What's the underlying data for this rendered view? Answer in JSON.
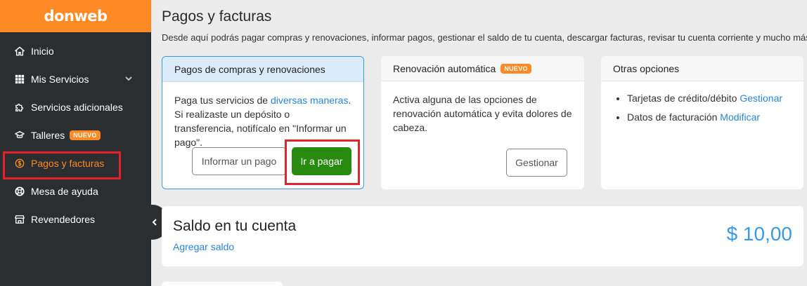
{
  "brand": {
    "name": "donweb"
  },
  "colors": {
    "accent": "#fd8a24",
    "link": "#2a86d9",
    "primary_button": "#298a10",
    "highlight": "#e4232a",
    "sidebar_bg": "#2b2e31"
  },
  "sidebar": {
    "items": [
      {
        "label": "Inicio",
        "icon": "home-icon"
      },
      {
        "label": "Mis Servicios",
        "icon": "grid-icon",
        "has_submenu": true
      },
      {
        "label": "Servicios adicionales",
        "icon": "puzzle-icon"
      },
      {
        "label": "Talleres",
        "icon": "graduation-cap-icon",
        "badge": "NUEVO"
      },
      {
        "label": "Pagos y facturas",
        "icon": "dollar-circle-icon",
        "active": true
      },
      {
        "label": "Mesa de ayuda",
        "icon": "lifebuoy-icon"
      },
      {
        "label": "Revendedores",
        "icon": "store-icon"
      }
    ]
  },
  "header": {
    "title": "Pagos y facturas",
    "description": "Desde aquí podrás pagar compras y renovaciones, informar pagos, gestionar el saldo de tu cuenta, descargar facturas, revisar tu cuenta corriente y mucho más..."
  },
  "cards": {
    "pagos": {
      "title": "Pagos de compras y renovaciones",
      "text_before_link": "Paga tus servicios de ",
      "link": "diversas maneras",
      "text_after_link": ". Si realizaste un depósito o transferencia, notifícalo en \"Informar un pago\".",
      "button_informar": "Informar un pago",
      "button_pagar": "Ir a pagar"
    },
    "renovacion": {
      "title": "Renovación automática",
      "badge": "NUEVO",
      "text": "Activa alguna de las opciones de renovación automática y evita dolores de cabeza.",
      "button": "Gestionar"
    },
    "otras": {
      "title": "Otras opciones",
      "items": [
        {
          "label": "Tarjetas de crédito/débito ",
          "link": "Gestionar"
        },
        {
          "label": "Datos de facturación ",
          "link": "Modificar"
        }
      ]
    },
    "saldo": {
      "title": "Saldo en tu cuenta",
      "link": "Agregar saldo",
      "amount": "$ 10,00"
    }
  }
}
